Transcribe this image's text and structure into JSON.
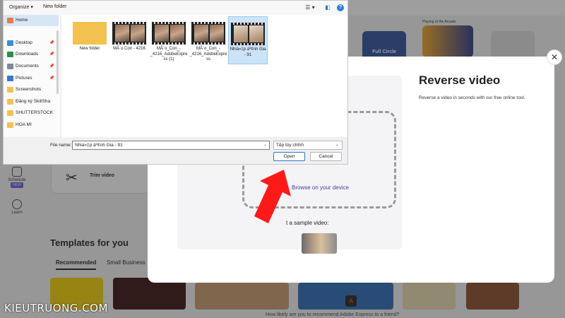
{
  "background": {
    "sidebar": [
      {
        "label": "Schedule",
        "badge": "NEW"
      },
      {
        "label": "Learn"
      }
    ],
    "trim_card": "Trim video",
    "templates_heading": "Templates for you",
    "tabs": [
      "Recommended",
      "Small Business"
    ],
    "full_circle_card": "Full Circle",
    "playing_label": "Playing at the Arcade",
    "recommend_text": "How likely are you to recommend Adobe Express to a friend?"
  },
  "modal": {
    "title": "Reverse video",
    "description": "Reverse a video in seconds with our free online tool.",
    "browse_link": "Browse on your device",
    "sample_label": "t a sample video:",
    "close_glyph": "✕"
  },
  "dialog": {
    "toolbar": {
      "organize": "Organize ▾",
      "new_folder": "New folder",
      "view_glyph": "☰ ▾",
      "pane_glyph": "◧",
      "help_glyph": "?"
    },
    "nav": [
      {
        "label": "Home",
        "selected": true,
        "icon": "home-icon",
        "color": "#e8794a"
      },
      {
        "label": "Desktop",
        "pinned": true,
        "icon": "desktop-icon",
        "color": "#3b8fd6"
      },
      {
        "label": "Downloads",
        "pinned": true,
        "icon": "downloads-icon",
        "color": "#2f8e4a"
      },
      {
        "label": "Documents",
        "pinned": true,
        "icon": "documents-icon",
        "color": "#7f8a99"
      },
      {
        "label": "Pictures",
        "pinned": true,
        "icon": "pictures-icon",
        "color": "#3a78c8"
      },
      {
        "label": "Screenshots",
        "icon": "folder-icon",
        "color": "#f3c14f"
      },
      {
        "label": "Đăng ký SkillSha",
        "icon": "folder-icon",
        "color": "#f3c14f"
      },
      {
        "label": "SHUTTERSTOCK",
        "icon": "folder-icon",
        "color": "#f3c14f"
      },
      {
        "label": "HOA MI",
        "icon": "folder-icon",
        "color": "#f3c14f"
      }
    ],
    "pin_glyph": "📌",
    "files": [
      {
        "name": "New folder",
        "type": "folder"
      },
      {
        "name": "MÃ´o Con - 4216",
        "type": "video"
      },
      {
        "name": "MÃ´o_Con_-_4216_AdobeExpress (1)",
        "type": "video"
      },
      {
        "name": "MÃ´o_Con_-_4216_AdobeExpress",
        "type": "video"
      },
      {
        "name": "Nhiá»‡p áº¢nh Gia - 91",
        "type": "video",
        "selected": true
      }
    ],
    "file_name_label": "File name:",
    "file_name_value": "Nhiá»‡p áº¢nh Gia - 91",
    "file_type_value": "Tệp tùy chỉnh",
    "dropdown_glyph": "⌄",
    "open_label": "Open",
    "cancel_label": "Cancel"
  },
  "watermark": "KIEUTRUONG.COM",
  "colors": {
    "accent": "#2a78d6",
    "arrow": "#ff1a1a",
    "link": "#3d3d9e"
  }
}
